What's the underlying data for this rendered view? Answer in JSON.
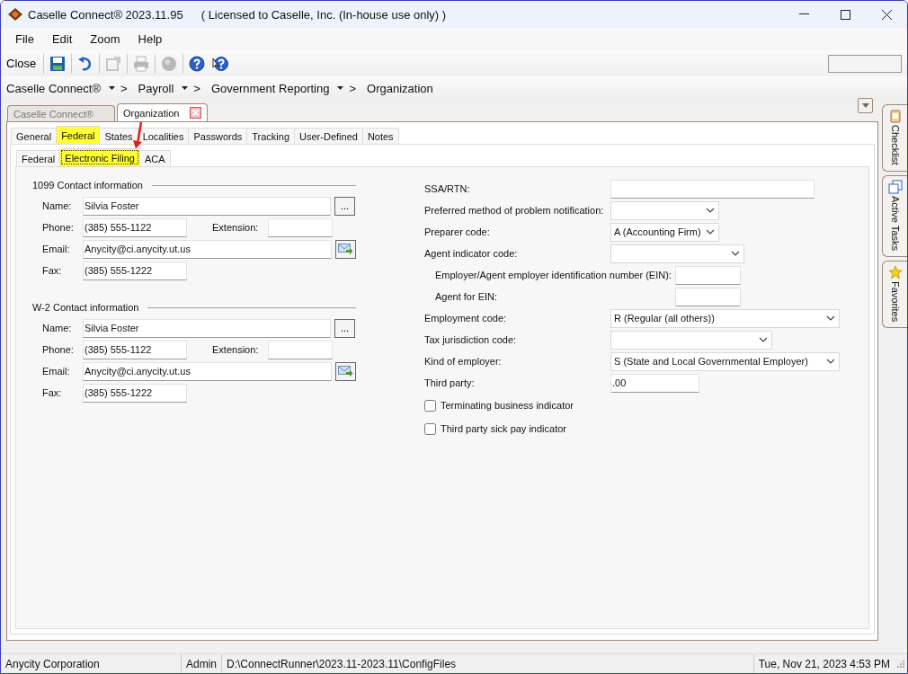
{
  "window": {
    "title": "Caselle Connect® 2023.11.95",
    "license": "( Licensed to Caselle, Inc. (In-house use only) )"
  },
  "menu": [
    "File",
    "Edit",
    "Zoom",
    "Help"
  ],
  "toolbar": {
    "close": "Close",
    "buttons": [
      {
        "kind": "save",
        "disabled": false
      },
      {
        "kind": "undo",
        "disabled": false
      },
      {
        "kind": "export",
        "disabled": true
      },
      {
        "kind": "print",
        "disabled": true
      },
      {
        "kind": "globe",
        "disabled": true
      },
      {
        "kind": "help",
        "disabled": false
      },
      {
        "kind": "help-pointer",
        "disabled": false
      }
    ]
  },
  "breadcrumb": {
    "separator": ">",
    "items": [
      {
        "label": "Caselle Connect®",
        "dropdown": true
      },
      {
        "label": "Payroll",
        "dropdown": true
      },
      {
        "label": "Government Reporting",
        "dropdown": true
      },
      {
        "label": "Organization",
        "dropdown": false
      }
    ]
  },
  "document_tabs": [
    {
      "label": "Caselle Connect®",
      "selected": false,
      "closable": false
    },
    {
      "label": "Organization",
      "selected": true,
      "closable": true
    }
  ],
  "tabs": [
    {
      "label": "General",
      "selected": false,
      "highlighted": false
    },
    {
      "label": "Federal",
      "selected": true,
      "highlighted": true
    },
    {
      "label": "States",
      "selected": false,
      "highlighted": false
    },
    {
      "label": "Localities",
      "selected": false,
      "highlighted": false
    },
    {
      "label": "Passwords",
      "selected": false,
      "highlighted": false
    },
    {
      "label": "Tracking",
      "selected": false,
      "highlighted": false
    },
    {
      "label": "User-Defined",
      "selected": false,
      "highlighted": false
    },
    {
      "label": "Notes",
      "selected": false,
      "highlighted": false
    }
  ],
  "subtabs": [
    {
      "label": "Federal",
      "selected": false,
      "highlighted": false
    },
    {
      "label": "Electronic Filing",
      "selected": true,
      "highlighted": true
    },
    {
      "label": "ACA",
      "selected": false,
      "highlighted": false
    }
  ],
  "contact_sections": [
    {
      "title": "1099 Contact information",
      "name": {
        "label": "Name:",
        "value": "Silvia Foster",
        "button": "..."
      },
      "phone": {
        "label": "Phone:",
        "value": "(385) 555-1122"
      },
      "extension": {
        "label": "Extension:"
      },
      "email": {
        "label": "Email:",
        "value": "Anycity@ci.anycity.ut.us"
      },
      "fax": {
        "label": "Fax:",
        "value": "(385) 555-1222"
      }
    },
    {
      "title": "W-2 Contact information",
      "name": {
        "label": "Name:",
        "value": "Silvia Foster",
        "button": "..."
      },
      "phone": {
        "label": "Phone:",
        "value": "(385) 555-1122"
      },
      "extension": {
        "label": "Extension:"
      },
      "email": {
        "label": "Email:",
        "value": "Anycity@ci.anycity.ut.us"
      },
      "fax": {
        "label": "Fax:",
        "value": "(385) 555-1222"
      }
    }
  ],
  "filing_fields": [
    {
      "kind": "text",
      "label": "SSA/RTN:",
      "indented": false
    },
    {
      "kind": "select",
      "label": "Preferred method of problem notification:",
      "indented": false
    },
    {
      "kind": "select",
      "label": "Preparer code:",
      "value": "A (Accounting Firm)",
      "indented": false
    },
    {
      "kind": "select",
      "label": "Agent indicator code:",
      "indented": false
    },
    {
      "kind": "text",
      "label": "Employer/Agent employer identification number (EIN):",
      "indented": true
    },
    {
      "kind": "text",
      "label": "Agent for EIN:",
      "indented": true
    },
    {
      "kind": "select",
      "label": "Employment code:",
      "value": "R (Regular (all others))",
      "indented": false
    },
    {
      "kind": "select",
      "label": "Tax jurisdiction code:",
      "indented": false
    },
    {
      "kind": "select",
      "label": "Kind of employer:",
      "value": "S (State and Local Governmental Employer)",
      "indented": false
    },
    {
      "kind": "text",
      "label": "Third party:",
      "value": ".00",
      "indented": false
    },
    {
      "kind": "checkbox",
      "label": "Terminating business indicator",
      "checked": false
    },
    {
      "kind": "checkbox",
      "label": "Third party sick pay indicator",
      "checked": false
    }
  ],
  "side_tabs": [
    "Checklist",
    "Active Tasks",
    "Favorites"
  ],
  "status_bar": [
    "Anycity Corporation",
    "Admin",
    "D:\\ConnectRunner\\2023.11-2023.11\\ConfigFiles",
    "Tue, Nov 21, 2023 4:53 PM"
  ]
}
